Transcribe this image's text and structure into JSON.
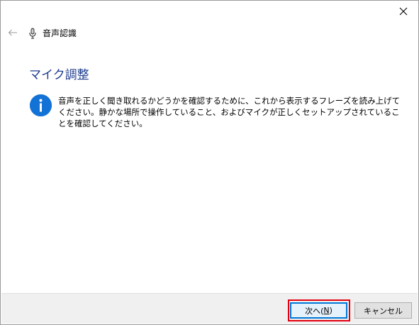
{
  "window": {
    "close_icon": "close-icon",
    "back_icon": "back-arrow-icon"
  },
  "header": {
    "app_icon": "microphone-icon",
    "app_title": "音声認識"
  },
  "main": {
    "page_title": "マイク調整",
    "info_icon": "info-icon",
    "info_text": "音声を正しく聞き取れるかどうかを確認するために、これから表示するフレーズを読み上げてください。静かな場所で操作していること、およびマイクが正しくセットアップされていることを確認してください。"
  },
  "footer": {
    "next_label_prefix": "次へ(",
    "next_label_accel": "N",
    "next_label_suffix": ")",
    "cancel_label": "キャンセル",
    "highlight_color": "#e3000f"
  }
}
